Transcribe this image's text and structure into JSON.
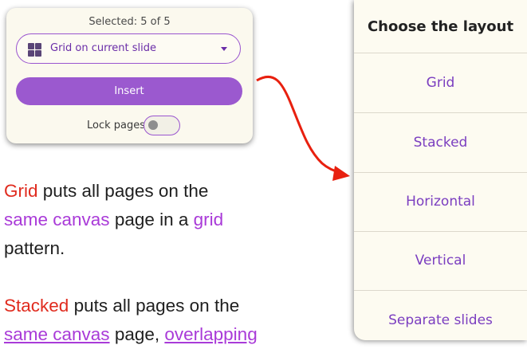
{
  "insert_panel": {
    "selected_text": "Selected: 5 of 5",
    "layout_select": {
      "value": "Grid on current slide",
      "icon": "grid-icon"
    },
    "insert_label": "Insert",
    "lock_label": "Lock pages",
    "lock_toggle_on": false
  },
  "layout_menu": {
    "title": "Choose the layout",
    "items": [
      "Grid",
      "Stacked",
      "Horizontal",
      "Vertical",
      "Separate slides"
    ]
  },
  "descriptions": {
    "grid": {
      "term": "Grid",
      "part1": " puts all pages on the ",
      "highlight1": "same canvas",
      "part2": " page in a ",
      "highlight2": "grid",
      "part3": " pattern."
    },
    "stacked": {
      "term": "Stacked",
      "part1": " puts all pages on the ",
      "highlight1": "same canvas",
      "part2": " page, ",
      "highlight2": "overlapping"
    }
  },
  "colors": {
    "accent_purple": "#9b59cf",
    "text_purple": "#a93ad8",
    "highlight_red": "#e02b1e",
    "arrow_red": "#e8200f"
  }
}
